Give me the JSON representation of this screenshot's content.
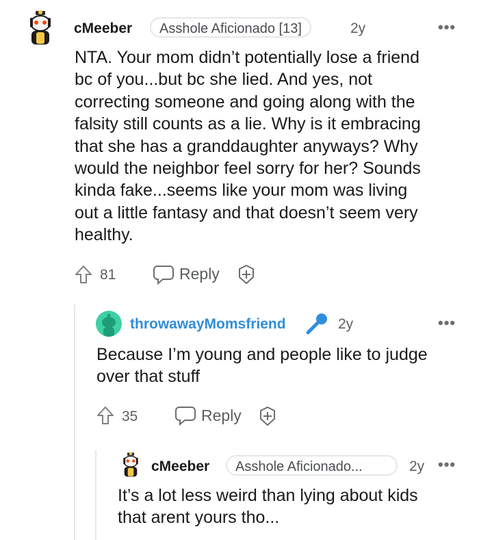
{
  "comments": [
    {
      "username": "cMeeber",
      "flair": "Asshole Aficionado [13]",
      "time": "2y",
      "more": "•••",
      "body": [
        "NTA. Your mom didn’t potentially lose a friend",
        "bc of you...but bc she lied. And yes, not",
        "correcting someone and going along with the",
        "falsity still counts as a lie. Why is it embracing",
        "that she has a granddaughter anyways? Why",
        "would the neighbor feel sorry for her? Sounds",
        "kinda fake...seems like your mom was living",
        "out a little fantasy and that doesn’t seem very",
        "healthy."
      ],
      "votes": "81",
      "reply_label": "Reply"
    },
    {
      "username": "throwawayMomsfriend",
      "time": "2y",
      "more": "•••",
      "body": [
        "Because I’m young and people like to judge",
        "over that stuff"
      ],
      "votes": "35",
      "reply_label": "Reply"
    },
    {
      "username": "cMeeber",
      "flair": "Asshole Aficionado...",
      "time": "2y",
      "more": "•••",
      "body": [
        "It’s a lot less weird than lying about kids",
        "that arent yours tho..."
      ]
    }
  ],
  "icons": {
    "avatar_1": "snoo-avatar-icon",
    "avatar_2": "snoo-avatar-icon",
    "upvote": "upvote-arrow-icon",
    "reply": "speech-bubble-icon",
    "award": "add-award-icon",
    "op": "microphone-icon"
  },
  "colors": {
    "op_username": "#2f8ddb",
    "avatar2_bg": "#3dd1a5",
    "muted_text": "#5c5f62"
  }
}
